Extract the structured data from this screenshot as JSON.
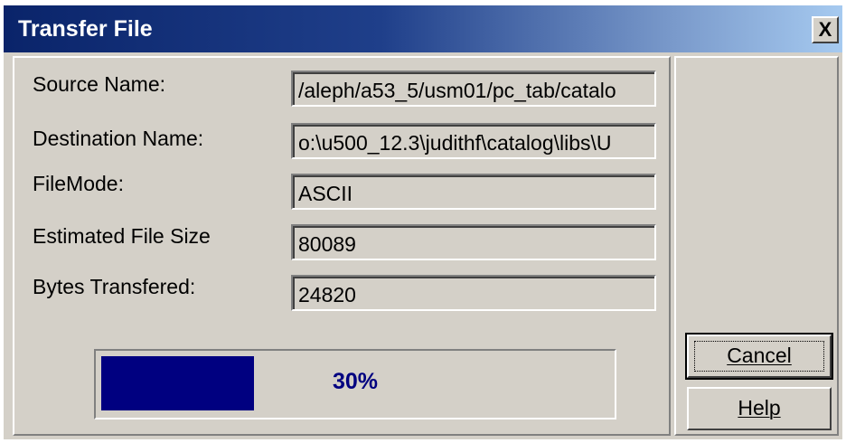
{
  "window": {
    "title": "Transfer File",
    "close_glyph": "X"
  },
  "fields": [
    {
      "label": "Source Name:",
      "value": "/aleph/a53_5/usm01/pc_tab/catalo"
    },
    {
      "label": "Destination Name:",
      "value": "o:\\u500_12.3\\judithf\\catalog\\libs\\U"
    },
    {
      "label": "FileMode:",
      "value": "ASCII"
    },
    {
      "label": "Estimated File Size",
      "value": "80089"
    },
    {
      "label": "Bytes Transfered:",
      "value": "24820"
    }
  ],
  "progress": {
    "percent": 30,
    "label": "30%",
    "fill_color": "#000080"
  },
  "buttons": {
    "cancel_label": "Cancel",
    "help_label": "Help"
  },
  "colors": {
    "face": "#d4d0c8",
    "titlebar_start": "#0a246a",
    "titlebar_end": "#a6caf0"
  }
}
